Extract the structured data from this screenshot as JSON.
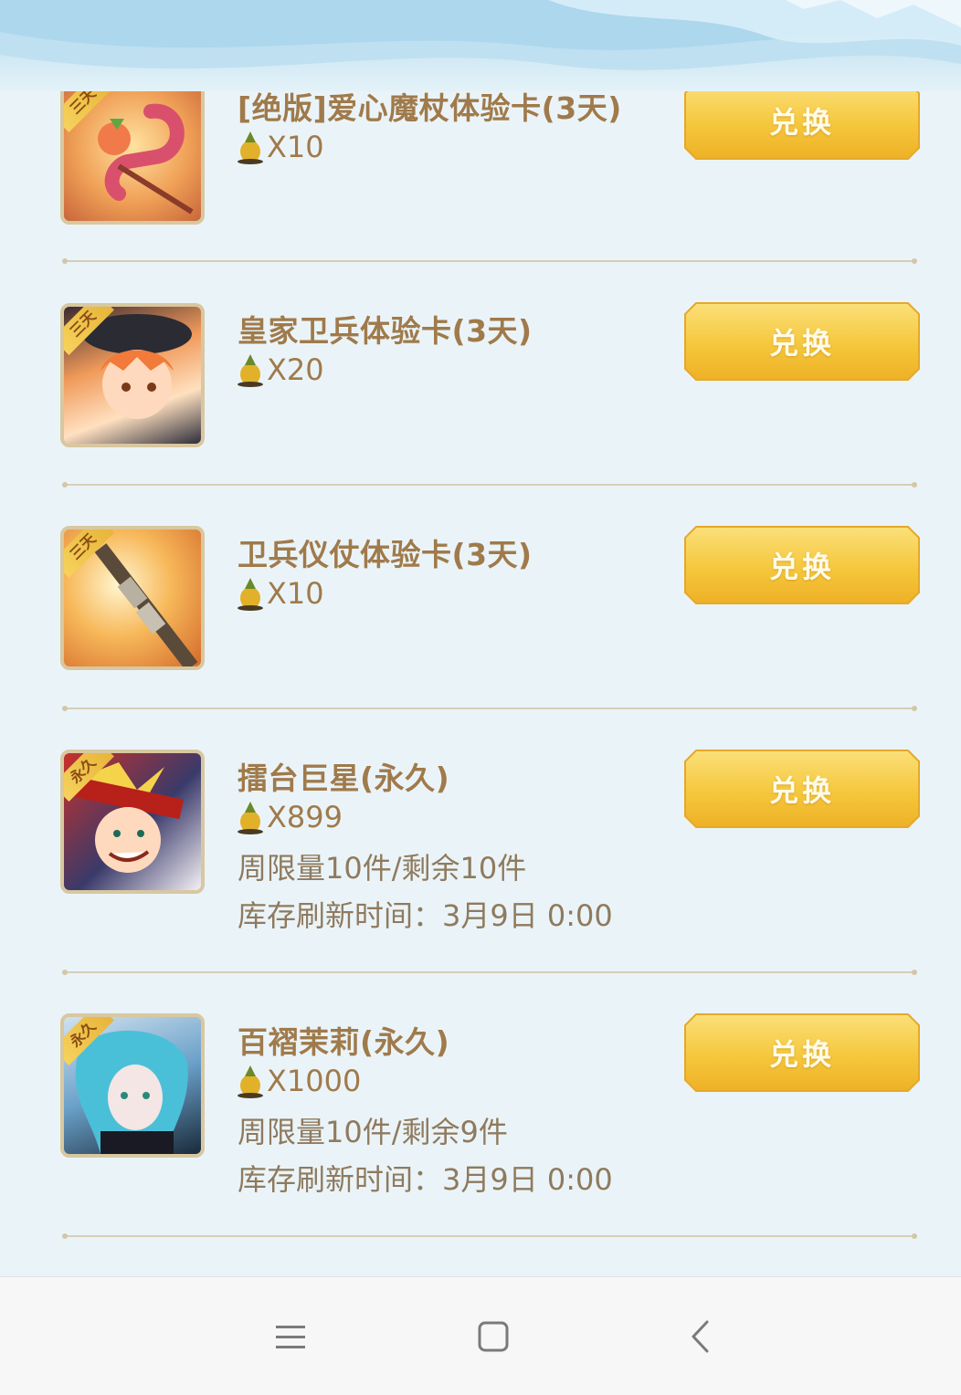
{
  "items": [
    {
      "title": "[绝版]爱心魔杖体验卡(3天)",
      "badge": "三天",
      "price": "X10",
      "limit": "",
      "refresh": "",
      "button": "兑换"
    },
    {
      "title": "皇家卫兵体验卡(3天)",
      "badge": "三天",
      "price": "X20",
      "limit": "",
      "refresh": "",
      "button": "兑换"
    },
    {
      "title": "卫兵仪仗体验卡(3天)",
      "badge": "三天",
      "price": "X10",
      "limit": "",
      "refresh": "",
      "button": "兑换"
    },
    {
      "title": "擂台巨星(永久)",
      "badge": "永久",
      "price": "X899",
      "limit": "周限量10件/剩余10件",
      "refresh": "库存刷新时间：3月9日 0:00",
      "button": "兑换"
    },
    {
      "title": "百褶茉莉(永久)",
      "badge": "永久",
      "price": "X1000",
      "limit": "周限量10件/剩余9件",
      "refresh": "库存刷新时间：3月9日 0:00",
      "button": "兑换"
    }
  ],
  "colors": {
    "title": "#a07a4b",
    "button_gold": "#f5c73c",
    "background": "#eaf4f8"
  },
  "currency_icon": "pineapple-icon",
  "nav": {
    "menu": "menu-icon",
    "home": "home-icon",
    "back": "back-icon"
  }
}
